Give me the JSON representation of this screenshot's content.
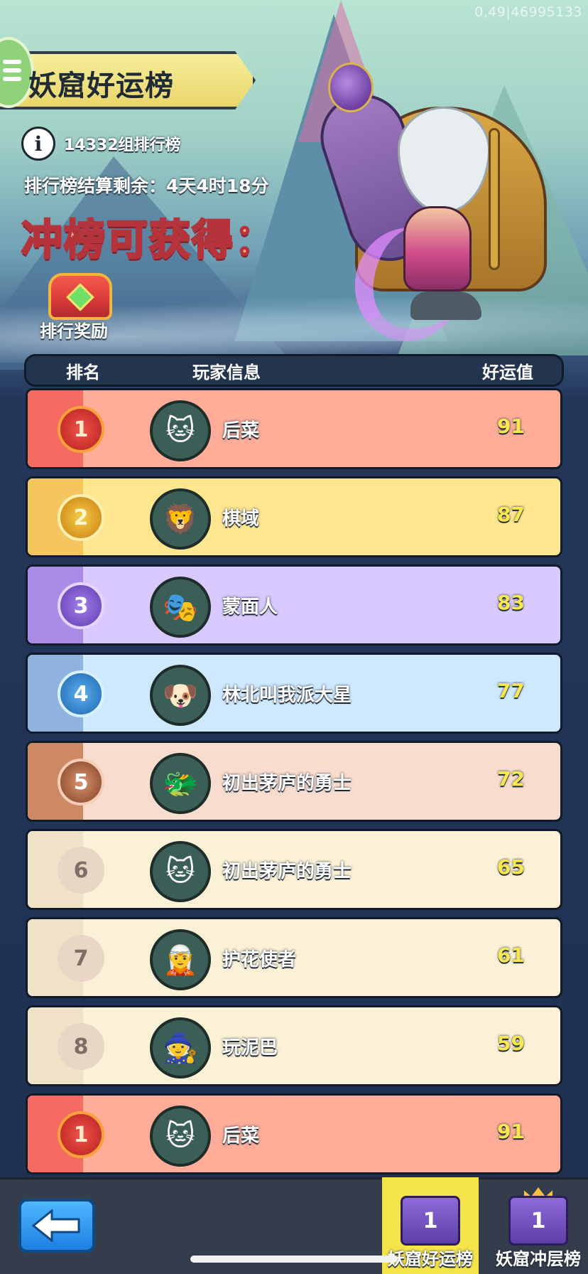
{
  "debug_coord": "0,49|46995133",
  "header": {
    "title": "妖窟好运榜",
    "group_text": "14332组排行榜",
    "countdown": "排行榜结算剩余：4天4时18分",
    "reward_heading": "冲榜可获得：",
    "reward_label": "排行奖励",
    "info_icon_glyph": "i"
  },
  "table": {
    "columns": {
      "rank": "排名",
      "player": "玩家信息",
      "luck": "好运值"
    },
    "rows": [
      {
        "rank": "1",
        "name": "后菜",
        "score": "91",
        "tier": "red",
        "avatar": "🐱"
      },
      {
        "rank": "2",
        "name": "棋域",
        "score": "87",
        "tier": "yellow",
        "avatar": "🦁"
      },
      {
        "rank": "3",
        "name": "蒙面人",
        "score": "83",
        "tier": "purple",
        "avatar": "🎭"
      },
      {
        "rank": "4",
        "name": "林北叫我派大星",
        "score": "77",
        "tier": "blue",
        "avatar": "🐶"
      },
      {
        "rank": "5",
        "name": "初出茅庐的勇士",
        "score": "72",
        "tier": "brown",
        "avatar": "🐲"
      },
      {
        "rank": "6",
        "name": "初出茅庐的勇士",
        "score": "65",
        "tier": "cream",
        "avatar": "🐱"
      },
      {
        "rank": "7",
        "name": "护花使者",
        "score": "61",
        "tier": "cream",
        "avatar": "🧝"
      },
      {
        "rank": "8",
        "name": "玩泥巴",
        "score": "59",
        "tier": "cream",
        "avatar": "🧙"
      },
      {
        "rank": "1",
        "name": "后菜",
        "score": "91",
        "tier": "red",
        "avatar": "🐱"
      }
    ]
  },
  "bottom": {
    "back_icon": "arrow-left-icon",
    "tabs": [
      {
        "label": "妖窟好运榜",
        "active": true,
        "badge": "1"
      },
      {
        "label": "妖窟冲层榜",
        "active": false,
        "badge": "1"
      }
    ]
  },
  "colors": {
    "title_bg": "#f6ee9b",
    "score": "#f8e84d",
    "active_tab": "#f4e34a",
    "back_button": "#1d7fe2"
  }
}
